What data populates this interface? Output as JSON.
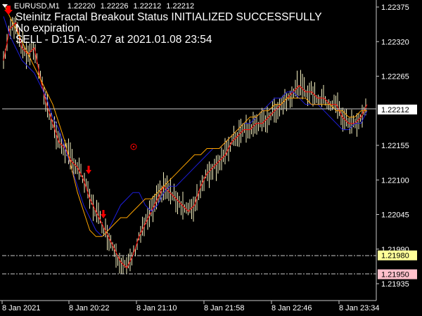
{
  "symbol_bar": {
    "symbol": "EURUSD,M1",
    "open": "1.22220",
    "high": "1.22226",
    "low": "1.22212",
    "close": "1.22212"
  },
  "status": {
    "line1": "Steinitz Fractal Breakout Status INITIALIZED SUCCESSFULLY",
    "line2": "No expiration",
    "line3": "SELL - D:15 A:-0.27 at 2021.01.08 23:54"
  },
  "price_axis": {
    "ticks": [
      {
        "label": "1.22375",
        "value": 1.22375
      },
      {
        "label": "1.22320",
        "value": 1.2232
      },
      {
        "label": "1.22265",
        "value": 1.22265
      },
      {
        "label": "1.22155",
        "value": 1.22155
      },
      {
        "label": "1.22100",
        "value": 1.221
      },
      {
        "label": "1.22045",
        "value": 1.22045
      },
      {
        "label": "1.21990",
        "value": 1.2199
      },
      {
        "label": "1.21935",
        "value": 1.21935
      }
    ],
    "current_price": {
      "label": "1.22212",
      "value": 1.22212,
      "bg": "#ffffff",
      "fg": "#000000"
    },
    "level_high": {
      "label": "1.21980",
      "value": 1.2198,
      "bg": "#ffff99",
      "fg": "#000000"
    },
    "level_low": {
      "label": "1.21950",
      "value": 1.2195,
      "bg": "#ffc0cb",
      "fg": "#000000"
    }
  },
  "time_axis": {
    "labels": [
      "8 Jan 2021",
      "8 Jan 20:22",
      "8 Jan 21:10",
      "8 Jan 21:58",
      "8 Jan 22:46",
      "8 Jan 23:34"
    ]
  },
  "chart_data": {
    "type": "line",
    "ylim": [
      1.21925,
      1.22385
    ],
    "price_min": 1.21935,
    "price_max": 1.22375,
    "series": [
      {
        "values": [
          1.2229,
          1.2234,
          1.2235,
          1.2231,
          1.223,
          1.2231,
          1.2226,
          1.2222,
          1.2219,
          1.2216,
          1.2215,
          1.2213,
          1.2212,
          1.221,
          1.2207,
          1.2205,
          1.2203,
          1.2201,
          1.2199,
          1.2197,
          1.2196,
          1.2198,
          1.2201,
          1.2203,
          1.2205,
          1.2207,
          1.2209,
          1.2208,
          1.2207,
          1.2206,
          1.2205,
          1.2206,
          1.2209,
          1.2211,
          1.2212,
          1.2213,
          1.2214,
          1.2216,
          1.2217,
          1.2218,
          1.2218,
          1.2219,
          1.2219,
          1.222,
          1.2221,
          1.2222,
          1.2223,
          1.2224,
          1.2225,
          1.2224,
          1.2224,
          1.2223,
          1.2223,
          1.2222,
          1.2222,
          1.222,
          1.2219,
          1.2219,
          1.222,
          1.2222
        ]
      },
      {
        "values": [
          1.2236,
          1.2233,
          1.2231,
          1.2229,
          1.2228,
          1.2227,
          1.2225,
          1.2223,
          1.222,
          1.2218,
          1.2215,
          1.2212,
          1.2209,
          1.2206,
          1.2204,
          1.2202,
          1.2201,
          1.2202,
          1.2204,
          1.2206,
          1.2207,
          1.2208,
          1.2208,
          1.2206,
          1.2205,
          1.2206,
          1.2208,
          1.2209,
          1.2209,
          1.221,
          1.2211,
          1.2212,
          1.2213,
          1.2214,
          1.2215,
          1.2215,
          1.2216,
          1.2217,
          1.2218,
          1.2219,
          1.2219,
          1.222,
          1.2221,
          1.2222,
          1.2223,
          1.2223,
          1.2224,
          1.2224,
          1.2223,
          1.2222,
          1.2222,
          1.2222,
          1.2221,
          1.222,
          1.2219,
          1.2218,
          1.2218,
          1.2219,
          1.2219,
          1.2221
        ]
      },
      {
        "values": [
          1.2238,
          1.2236,
          1.2234,
          1.2232,
          1.223,
          1.2228,
          1.2226,
          1.2224,
          1.2222,
          1.2219,
          1.2216,
          1.2212,
          1.2208,
          1.2205,
          1.2202,
          1.2201,
          1.2201,
          1.2202,
          1.2203,
          1.2204,
          1.2204,
          1.2205,
          1.2206,
          1.2207,
          1.2207,
          1.2208,
          1.2209,
          1.221,
          1.2211,
          1.2212,
          1.2213,
          1.2214,
          1.2214,
          1.2215,
          1.2215,
          1.2215,
          1.2216,
          1.2217,
          1.2218,
          1.2219,
          1.222,
          1.222,
          1.2221,
          1.2221,
          1.2222,
          1.2222,
          1.2223,
          1.2223,
          1.2223,
          1.2223,
          1.2222,
          1.2222,
          1.2222,
          1.2222,
          1.2221,
          1.2221,
          1.222,
          1.222,
          1.2221,
          1.2221
        ]
      }
    ],
    "line_colors": [
      "#ff0000",
      "#1e1edc",
      "#ffa500"
    ],
    "bar_color": "#f5f0c0",
    "grid_color": "#c8c8c8",
    "sell_arrow_color": "#ff0000",
    "marker_color": "#ff0000"
  }
}
